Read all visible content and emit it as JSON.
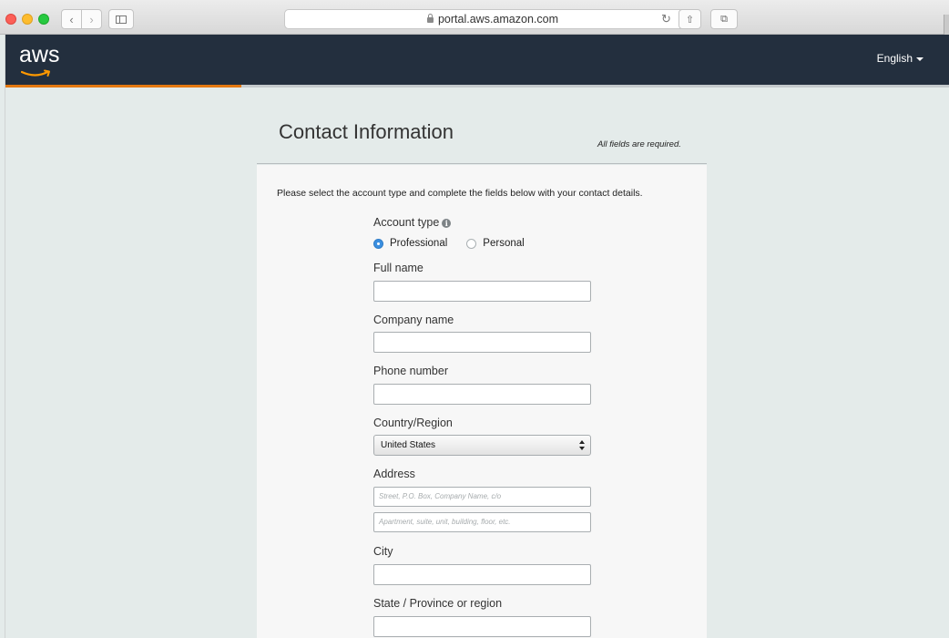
{
  "browser": {
    "url": "portal.aws.amazon.com"
  },
  "header": {
    "logo_text": "aws",
    "language": "English",
    "signup_progress": 0.25,
    "accent": "#e47911",
    "bar_color": "#232f3e"
  },
  "form": {
    "title": "Contact Information",
    "required_note": "All fields are required.",
    "intro": "Please select the account type and complete the fields below with your contact details.",
    "account_type": {
      "label": "Account type",
      "options": [
        "Professional",
        "Personal"
      ],
      "selected": "Professional"
    },
    "full_name": {
      "label": "Full name",
      "value": ""
    },
    "company_name": {
      "label": "Company name",
      "value": ""
    },
    "phone_number": {
      "label": "Phone number",
      "value": ""
    },
    "country": {
      "label": "Country/Region",
      "value": "United States"
    },
    "address": {
      "label": "Address",
      "line1_placeholder": "Street, P.O. Box, Company Name, c/o",
      "line2_placeholder": "Apartment, suite, unit, building, floor, etc."
    },
    "city": {
      "label": "City",
      "value": ""
    },
    "state": {
      "label": "State / Province or region",
      "value": ""
    }
  },
  "icons": {
    "lock": "lock-icon",
    "reload": "reload-icon",
    "share": "share-icon",
    "tabs": "tabs-icon",
    "info": "info-icon"
  }
}
